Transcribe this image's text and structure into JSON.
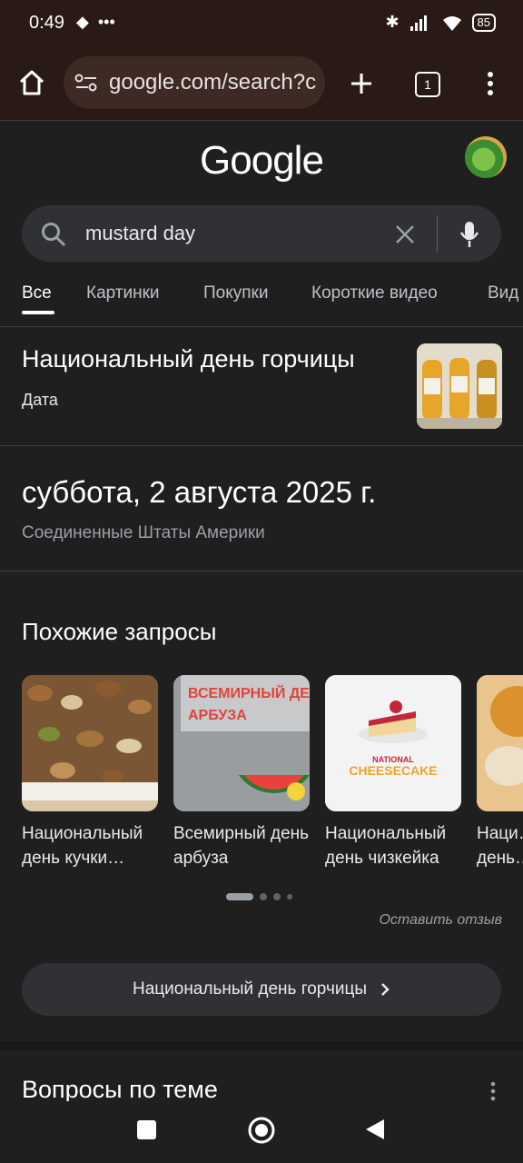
{
  "status_bar": {
    "time": "0:49",
    "battery": "85"
  },
  "browser": {
    "url": "google.com/search?c",
    "tab_count": "1"
  },
  "google": {
    "logo": "Google"
  },
  "search": {
    "query": "mustard day"
  },
  "tabs": [
    "Все",
    "Картинки",
    "Покупки",
    "Короткие видео",
    "Вид"
  ],
  "answer": {
    "title": "Национальный день горчицы",
    "subtitle": "Дата",
    "date": "суббота, 2 августа 2025 г.",
    "country": "Соединенные Штаты Америки"
  },
  "related": {
    "heading": "Похожие запросы",
    "items": [
      {
        "label": "Национальный день кучки…"
      },
      {
        "label": "Всемирный день арбуза",
        "image_text": "ВСЕМИРНЫЙ ДЕ АРБУЗА"
      },
      {
        "label": "Национальный день чизкейка",
        "image_text": "NATIONAL CHEESECAKE"
      },
      {
        "label": "Наци… день…"
      }
    ],
    "feedback": "Оставить отзыв",
    "more_button": "Национальный день горчицы"
  },
  "questions": {
    "heading": "Вопросы по теме"
  }
}
